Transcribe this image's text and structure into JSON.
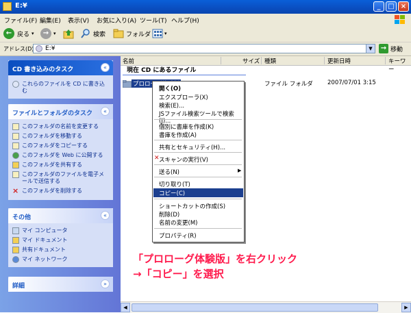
{
  "window": {
    "title": "E:¥"
  },
  "menubar": {
    "items": [
      "ファイル(F)",
      "編集(E)",
      "表示(V)",
      "お気に入り(A)",
      "ツール(T)",
      "ヘルプ(H)"
    ]
  },
  "toolbar": {
    "back": "戻る",
    "search": "検索",
    "folders": "フォルダ"
  },
  "address": {
    "label": "アドレス(D)",
    "value": "E:¥",
    "go": "移動"
  },
  "left": {
    "cd_tasks": {
      "title": "CD 書き込みのタスク",
      "items": [
        "これらのファイルを CD に書き込む"
      ]
    },
    "file_tasks": {
      "title": "ファイルとフォルダのタスク",
      "items": [
        "このフォルダの名前を変更する",
        "このフォルダを移動する",
        "このフォルダをコピーする",
        "このフォルダを Web に公開する",
        "このフォルダを共有する",
        "このフォルダのファイルを電子メールで送信する",
        "このフォルダを削除する"
      ]
    },
    "other": {
      "title": "その他",
      "items": [
        "マイ コンピュータ",
        "マイ ドキュメント",
        "共有ドキュメント",
        "マイ ネットワーク"
      ]
    },
    "details": {
      "title": "詳細"
    }
  },
  "columns": {
    "name": "名前",
    "size": "サイズ",
    "type": "種類",
    "date": "更新日時",
    "keyword": "キーワー"
  },
  "group_header": "現在 CD にあるファイル",
  "file": {
    "name": "プロローグ体験版",
    "type": "ファイル フォルダ",
    "date": "2007/07/01 3:15"
  },
  "context_menu": {
    "items": [
      "開く(O)",
      "エクスプローラ(X)",
      "検索(E)...",
      "JSファイル検索ツールで検索(J)...",
      "個別に書庫を作成(K)",
      "書庫を作成(A)",
      "共有とセキュリティ(H)...",
      "スキャンの実行(V)",
      "送る(N)",
      "切り取り(T)",
      "コピー(C)",
      "ショートカットの作成(S)",
      "削除(D)",
      "名前の変更(M)",
      "プロパティ(R)"
    ],
    "selected": "コピー(C)"
  },
  "annotation": {
    "line1": "「プロローグ体験版」を右クリック",
    "line2": "→「コピー」を選択"
  },
  "colors": {
    "title": "#0a4ec0",
    "selection": "#1c3f8f",
    "annotation": "#ff1b4d",
    "panel_bg": "#6375d6"
  }
}
